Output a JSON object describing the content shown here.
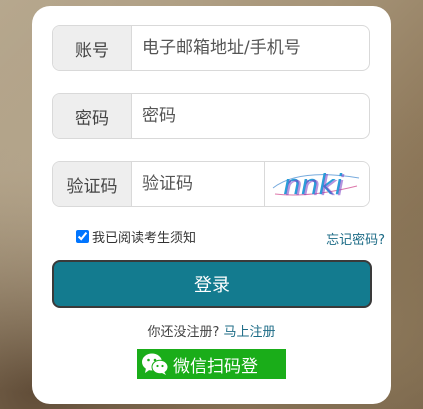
{
  "form": {
    "account": {
      "label": "账号",
      "placeholder": "电子邮箱地址/手机号"
    },
    "password": {
      "label": "密码",
      "placeholder": "密码"
    },
    "captcha": {
      "label": "验证码",
      "placeholder": "验证码",
      "image_text": "nnki"
    },
    "agree": {
      "prefix": "我已阅读",
      "link": "考生须知",
      "checked": true
    },
    "forgot_password": "忘记密码?",
    "login_button": "登录",
    "register": {
      "prompt": "你还没注册?",
      "link": "马上注册"
    },
    "wechat_login": "微信扫码登"
  },
  "colors": {
    "primary": "#137b8f",
    "link": "#1c6b86",
    "wechat": "#1aad19"
  }
}
